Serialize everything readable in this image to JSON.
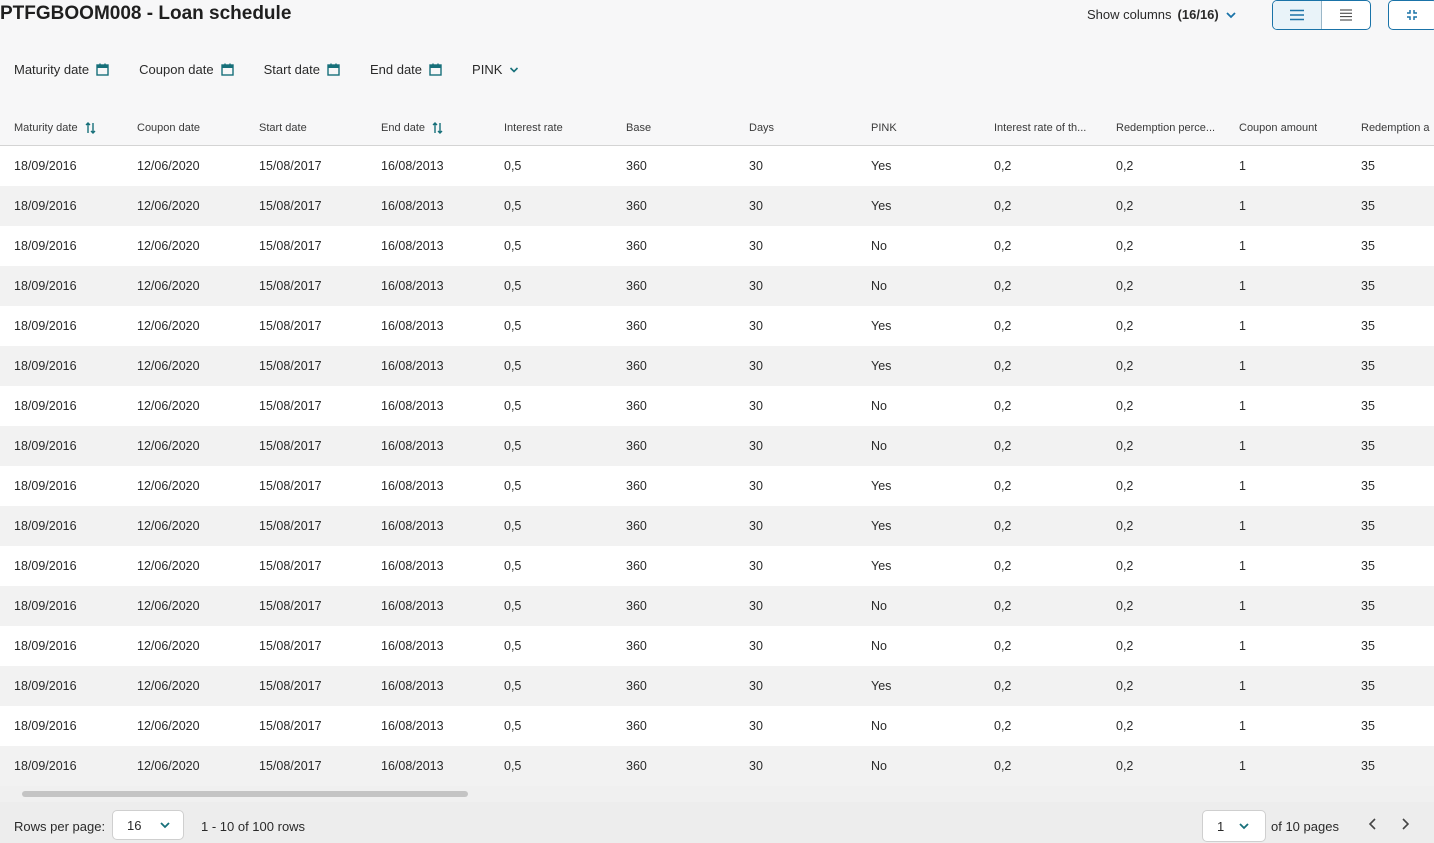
{
  "header": {
    "title": "PTFGBOOM008 - Loan schedule",
    "show_columns_label": "Show columns",
    "show_columns_count": "(16/16)"
  },
  "filters": [
    {
      "label": "Maturity date",
      "icon": "calendar-icon"
    },
    {
      "label": "Coupon date",
      "icon": "calendar-icon"
    },
    {
      "label": "Start date",
      "icon": "calendar-icon"
    },
    {
      "label": "End date",
      "icon": "calendar-icon"
    },
    {
      "label": "PINK",
      "icon": "chevron-down-icon"
    }
  ],
  "columns": [
    "Maturity date",
    "Coupon date",
    "Start date",
    "End date",
    "Interest rate",
    "Base",
    "Days",
    "PINK",
    "Interest rate of th...",
    "Redemption perce...",
    "Coupon amount",
    "Redemption a"
  ],
  "rows": [
    [
      "18/09/2016",
      "12/06/2020",
      "15/08/2017",
      "16/08/2013",
      "0,5",
      "360",
      "30",
      "Yes",
      "0,2",
      "0,2",
      "1",
      "35"
    ],
    [
      "18/09/2016",
      "12/06/2020",
      "15/08/2017",
      "16/08/2013",
      "0,5",
      "360",
      "30",
      "Yes",
      "0,2",
      "0,2",
      "1",
      "35"
    ],
    [
      "18/09/2016",
      "12/06/2020",
      "15/08/2017",
      "16/08/2013",
      "0,5",
      "360",
      "30",
      "No",
      "0,2",
      "0,2",
      "1",
      "35"
    ],
    [
      "18/09/2016",
      "12/06/2020",
      "15/08/2017",
      "16/08/2013",
      "0,5",
      "360",
      "30",
      "No",
      "0,2",
      "0,2",
      "1",
      "35"
    ],
    [
      "18/09/2016",
      "12/06/2020",
      "15/08/2017",
      "16/08/2013",
      "0,5",
      "360",
      "30",
      "Yes",
      "0,2",
      "0,2",
      "1",
      "35"
    ],
    [
      "18/09/2016",
      "12/06/2020",
      "15/08/2017",
      "16/08/2013",
      "0,5",
      "360",
      "30",
      "Yes",
      "0,2",
      "0,2",
      "1",
      "35"
    ],
    [
      "18/09/2016",
      "12/06/2020",
      "15/08/2017",
      "16/08/2013",
      "0,5",
      "360",
      "30",
      "No",
      "0,2",
      "0,2",
      "1",
      "35"
    ],
    [
      "18/09/2016",
      "12/06/2020",
      "15/08/2017",
      "16/08/2013",
      "0,5",
      "360",
      "30",
      "No",
      "0,2",
      "0,2",
      "1",
      "35"
    ],
    [
      "18/09/2016",
      "12/06/2020",
      "15/08/2017",
      "16/08/2013",
      "0,5",
      "360",
      "30",
      "Yes",
      "0,2",
      "0,2",
      "1",
      "35"
    ],
    [
      "18/09/2016",
      "12/06/2020",
      "15/08/2017",
      "16/08/2013",
      "0,5",
      "360",
      "30",
      "Yes",
      "0,2",
      "0,2",
      "1",
      "35"
    ],
    [
      "18/09/2016",
      "12/06/2020",
      "15/08/2017",
      "16/08/2013",
      "0,5",
      "360",
      "30",
      "Yes",
      "0,2",
      "0,2",
      "1",
      "35"
    ],
    [
      "18/09/2016",
      "12/06/2020",
      "15/08/2017",
      "16/08/2013",
      "0,5",
      "360",
      "30",
      "No",
      "0,2",
      "0,2",
      "1",
      "35"
    ],
    [
      "18/09/2016",
      "12/06/2020",
      "15/08/2017",
      "16/08/2013",
      "0,5",
      "360",
      "30",
      "No",
      "0,2",
      "0,2",
      "1",
      "35"
    ],
    [
      "18/09/2016",
      "12/06/2020",
      "15/08/2017",
      "16/08/2013",
      "0,5",
      "360",
      "30",
      "Yes",
      "0,2",
      "0,2",
      "1",
      "35"
    ],
    [
      "18/09/2016",
      "12/06/2020",
      "15/08/2017",
      "16/08/2013",
      "0,5",
      "360",
      "30",
      "No",
      "0,2",
      "0,2",
      "1",
      "35"
    ],
    [
      "18/09/2016",
      "12/06/2020",
      "15/08/2017",
      "16/08/2013",
      "0,5",
      "360",
      "30",
      "No",
      "0,2",
      "0,2",
      "1",
      "35"
    ]
  ],
  "footer": {
    "rows_per_page_label": "Rows per page:",
    "rows_per_page_value": "16",
    "range_text": "1 - 10 of 100 rows",
    "page_value": "1",
    "of_pages_text": "of 10 pages"
  },
  "colors": {
    "accent": "#1a73a8",
    "icon_teal": "#17707a"
  }
}
